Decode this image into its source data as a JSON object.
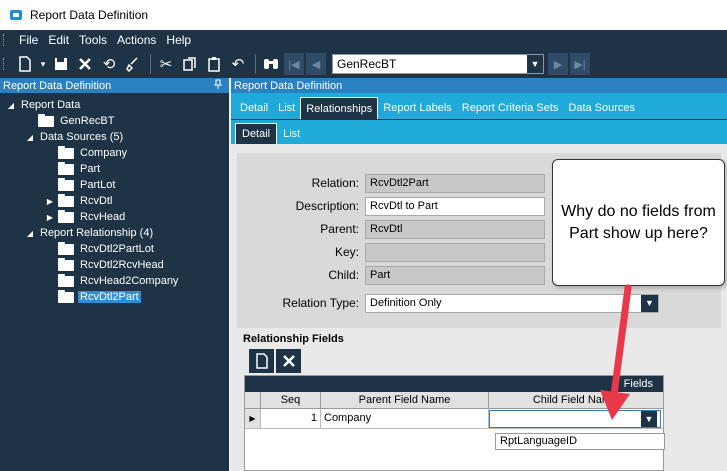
{
  "window": {
    "title": "Report Data Definition"
  },
  "menu": [
    "File",
    "Edit",
    "Tools",
    "Actions",
    "Help"
  ],
  "toolbar": {
    "record_value": "GenRecBT"
  },
  "left_panel": {
    "header": "Report Data Definition",
    "pin": "⌄",
    "tree": {
      "root": "Report Data",
      "genrec": "GenRecBT",
      "data_sources": "Data Sources (5)",
      "ds_items": [
        "Company",
        "Part",
        "PartLot",
        "RcvDtl",
        "RcvHead"
      ],
      "report_relationship": "Report Relationship (4)",
      "rr_items": [
        "RcvDtl2PartLot",
        "RcvDtl2RcvHead",
        "RcvHead2Company",
        "RcvDtl2Part"
      ]
    }
  },
  "right_panel": {
    "header": "Report Data Definition",
    "tabs": [
      "Detail",
      "List",
      "Relationships",
      "Report Labels",
      "Report Criteria Sets",
      "Data Sources"
    ],
    "subtabs": [
      "Detail",
      "List"
    ],
    "form": {
      "relation_label": "Relation:",
      "relation_value": "RcvDtl2Part",
      "description_label": "Description:",
      "description_value": "RcvDtl to Part",
      "parent_label": "Parent:",
      "parent_value": "RcvDtl",
      "key_label": "Key:",
      "key_value": "",
      "child_label": "Child:",
      "child_value": "Part",
      "relation_type_label": "Relation Type:",
      "relation_type_value": "Definition Only"
    },
    "relationship_fields": {
      "title": "Relationship Fields",
      "band": "Fields",
      "columns": [
        "Seq",
        "Parent Field Name",
        "Child Field Name"
      ],
      "rows": [
        {
          "seq": "1",
          "parent": "Company",
          "child": ""
        }
      ],
      "dropdown_option": "RptLanguageID"
    }
  },
  "callout": {
    "text": "Why do no fields from Part show up here?"
  },
  "colors": {
    "dark": "#1f3347",
    "accent": "#2a81c2",
    "tab_bar": "#1faad9",
    "arrow": "#e8384a"
  }
}
